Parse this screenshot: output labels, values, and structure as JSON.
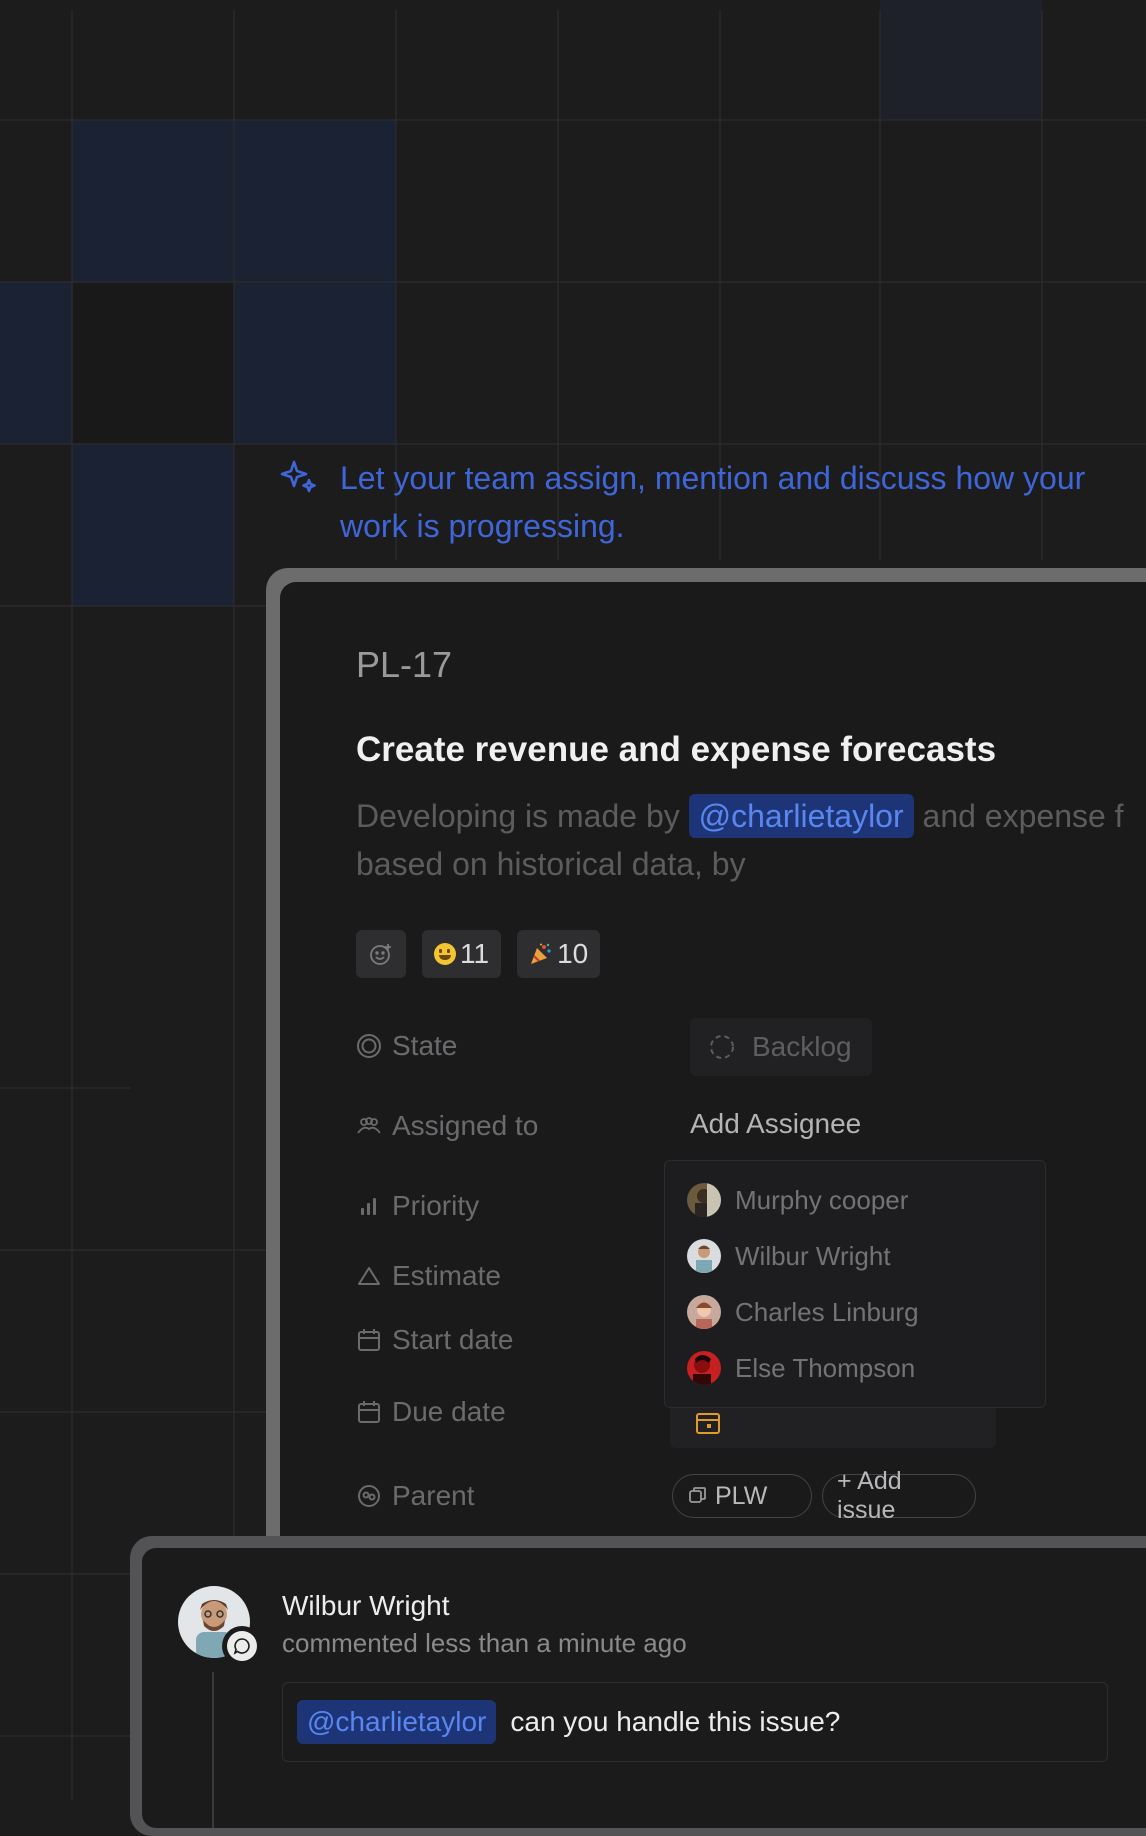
{
  "tagline": {
    "text": "Let your team assign, mention and discuss how your work is progressing.",
    "icon": "sparkle-icon",
    "color": "#3f66d8"
  },
  "issue": {
    "id": "PL-17",
    "title": "Create revenue and expense forecasts",
    "description": {
      "before": "Developing is made by ",
      "mention": "@charlietaylor",
      "after": " and expense f",
      "line2": "based on historical data, by"
    },
    "reactions": [
      {
        "emoji": "grinning-face",
        "count": "11"
      },
      {
        "emoji": "party-popper",
        "count": "10"
      }
    ],
    "properties": {
      "state": {
        "label": "State",
        "value": "Backlog"
      },
      "assigned_to": {
        "label": "Assigned to",
        "value": "Add Assignee"
      },
      "priority": {
        "label": "Priority"
      },
      "estimate": {
        "label": "Estimate"
      },
      "start_date": {
        "label": "Start date"
      },
      "due_date": {
        "label": "Due date"
      },
      "parent": {
        "label": "Parent",
        "chip": "PLW",
        "add_label": "+ Add issue"
      }
    }
  },
  "assignee_dropdown": {
    "options": [
      "Murphy cooper",
      "Wilbur Wright",
      "Charles Linburg",
      "Else Thompson"
    ]
  },
  "comment": {
    "author": "Wilbur Wright",
    "time": "commented less than a minute ago",
    "mention": "@charlietaylor",
    "text": "can you handle this issue?"
  },
  "colors": {
    "accent": "#3f66d8",
    "mention_bg": "#1d3577",
    "mention_text": "#5a86f0",
    "background": "#1c1c1d"
  }
}
